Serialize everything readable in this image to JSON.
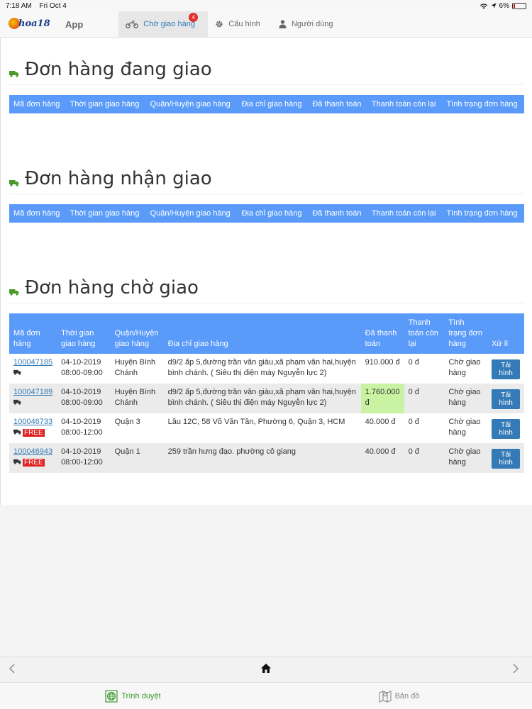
{
  "statusbar": {
    "time": "7:18 AM",
    "date": "Fri Oct 4",
    "battery": "6%"
  },
  "navbar": {
    "brand": "App",
    "tabs": [
      {
        "label": "Chờ giao hàng",
        "badge": "4",
        "icon": "motorbike-icon"
      },
      {
        "label": "Cấu hình",
        "icon": "gear-icon"
      },
      {
        "label": "Người dùng",
        "icon": "user-icon"
      }
    ]
  },
  "columns_short": [
    "Mã đơn hàng",
    "Thời gian giao hàng",
    "Quận/Huyện giao hàng",
    "Địa chỉ giao hàng",
    "Đã thanh toán",
    "Thanh toán còn lại",
    "Tình trạng đơn hàng"
  ],
  "columns_full": [
    "Mã đơn hàng",
    "Thời gian giao hàng",
    "Quận/Huyện giao hàng",
    "Địa chỉ giao hàng",
    "Đã thanh toán",
    "Thanh toán còn lại",
    "Tình trạng đơn hàng",
    "Xử lí"
  ],
  "sections": {
    "delivering": {
      "title": "Đơn hàng đang giao"
    },
    "accepted": {
      "title": "Đơn hàng nhận giao"
    },
    "waiting": {
      "title": "Đơn hàng chờ giao",
      "rows": [
        {
          "id": "100047185",
          "free": false,
          "date": "04-10-2019",
          "time": "08:00-09:00",
          "district": "Huyện Bình Chánh",
          "address": "d9/2 ấp 5,đường trần văn giàu,xã phạm văn hai,huyện bình chánh. ( Siêu thị điện máy Nguyễn lực 2)",
          "paid": "910.000 đ",
          "paid_highlight": false,
          "remaining": "0 đ",
          "status": "Chờ giao hàng",
          "action": "Tải hình"
        },
        {
          "id": "100047189",
          "free": false,
          "date": "04-10-2019",
          "time": "08:00-09:00",
          "district": "Huyện Bình Chánh",
          "address": "d9/2 ấp 5,đường trần văn giàu,xã phạm văn hai,huyện bình chánh. ( Siêu thị điện máy Nguyễn lực 2)",
          "paid": "1.760.000 đ",
          "paid_highlight": true,
          "remaining": "0 đ",
          "status": "Chờ giao hàng",
          "action": "Tải hình"
        },
        {
          "id": "100046733",
          "free": true,
          "date": "04-10-2019",
          "time": "08:00-12:00",
          "district": "Quận 3",
          "address": "Lầu 12C, 58 Võ Văn Tần, Phường 6, Quận 3, HCM",
          "paid": "40.000 đ",
          "paid_highlight": false,
          "remaining": "0 đ",
          "status": "Chờ giao hàng",
          "action": "Tải hình"
        },
        {
          "id": "100046943",
          "free": true,
          "date": "04-10-2019",
          "time": "08:00-12:00",
          "district": "Quận 1",
          "address": "259 trần hưng đạo. phường cô giang",
          "paid": "40.000 đ",
          "paid_highlight": false,
          "remaining": "0 đ",
          "status": "Chờ giao hàng",
          "action": "Tải hình"
        }
      ]
    }
  },
  "free_label": "FREE",
  "bottom_tabs": [
    {
      "label": "Trình duyệt",
      "icon": "globe-icon"
    },
    {
      "label": "Bản đồ",
      "icon": "map-icon"
    }
  ],
  "colors": {
    "header_blue": "#5a9bfa",
    "link": "#337ab7",
    "paid_highlight": "#c9f2a2",
    "free_red": "#e02020",
    "tab_active": "#3a9b2c"
  }
}
